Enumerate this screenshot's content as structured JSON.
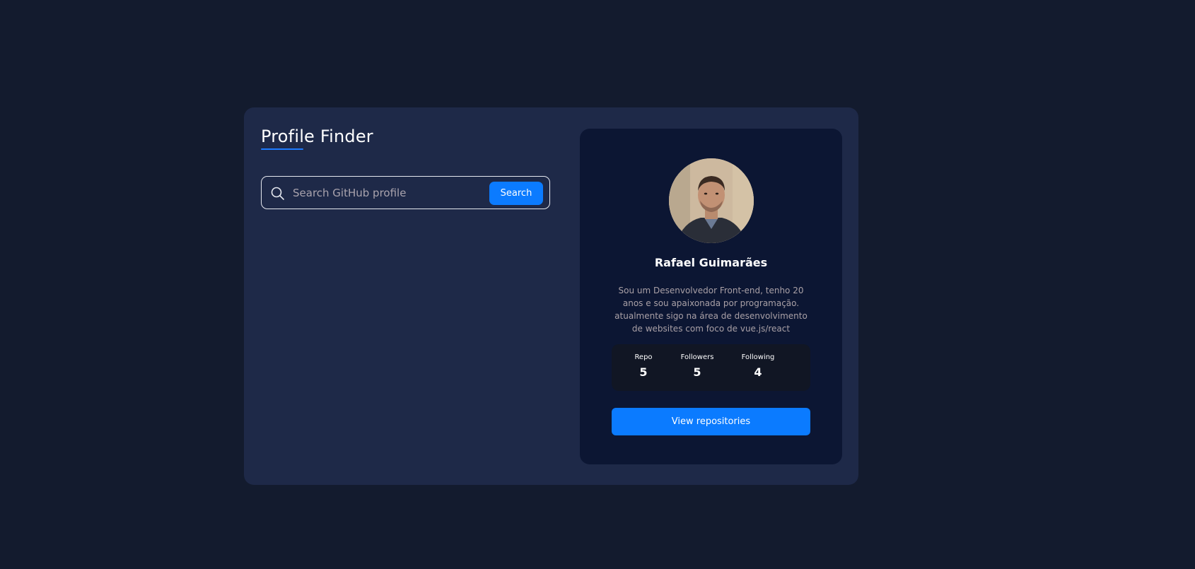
{
  "app": {
    "title": "Profile Finder"
  },
  "search": {
    "placeholder": "Search GitHub profile",
    "value": "",
    "button_label": "Search",
    "icon": "search-icon"
  },
  "profile": {
    "avatar_alt": "Rafael Guimarães",
    "name": "Rafael Guimarães",
    "bio": "Sou um Desenvolvedor Front-end, tenho 20 anos e sou apaixonada por programação. atualmente sigo na área de desenvolvimento de websites com foco de vue.js/react",
    "stats": [
      {
        "label": "Repo",
        "value": "5"
      },
      {
        "label": "Followers",
        "value": "5"
      },
      {
        "label": "Following",
        "value": "4"
      }
    ],
    "view_repos_label": "View repositories"
  },
  "colors": {
    "page_background": "#131b2e",
    "panel_background": "#1e2948",
    "card_background": "#0c1633",
    "stats_background": "#111624",
    "accent": "#0b7bff"
  }
}
